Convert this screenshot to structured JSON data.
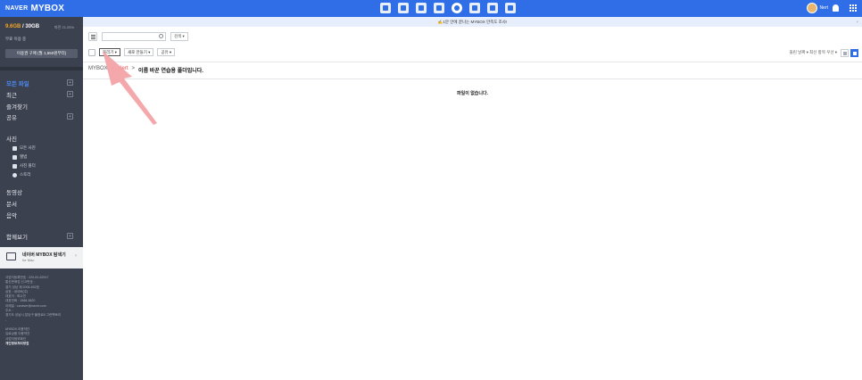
{
  "brand": {
    "naver": "NAVER",
    "mybox": "MYBOX"
  },
  "topbar": {
    "apps": [
      "mail-icon",
      "calendar-icon",
      "memo-icon",
      "contacts-icon",
      "mybox-icon",
      "office-icon",
      "cafe-icon",
      "more-icon"
    ],
    "user_name": "Nert"
  },
  "sidebar": {
    "quota_used": "9.6GB",
    "quota_sep": " / ",
    "quota_total": "30GB",
    "quota_sub": "파란 21.25%",
    "free_text": "무료 이용 중",
    "buy_label": "이용권 구매 (월 1,650원부터)",
    "menu": [
      {
        "label": "모든 파일",
        "plus": "+"
      },
      {
        "label": "최근",
        "plus": "+"
      },
      {
        "label": "즐겨찾기"
      },
      {
        "label": "공유",
        "plus": "+"
      }
    ],
    "photo_title": "사진",
    "photo_items": [
      "모든 사진",
      "앨범",
      "사진 폴더",
      "스토리"
    ],
    "media": [
      "동영상",
      "문서",
      "음악"
    ],
    "shared_title": "함께보기",
    "shared_plus": "+",
    "promo_title": "네이버 MYBOX 탐색기",
    "promo_sub": "for Mac",
    "footer": [
      "사업자등록번호 : 220-81-62517",
      "통신판매업 신고번호 :",
      "경기 성남 제 2006-692호",
      "상호 : 네이버(주)",
      "대표자 : 최수연",
      "대표전화 : 1588-3820",
      "이메일 : ccnaver@naver.com",
      "주소 :",
      "경기도 성남시 분당구 불정로6 그린팩토리",
      "-"
    ],
    "footer_links": [
      "MYBOX 이용약관",
      "유료상품 이용약관",
      "사업자정보확인",
      "개인정보처리방침"
    ]
  },
  "notice": {
    "text": "✍️1분 안에 끝나는 MYBOX 만족도 조사!",
    "close": "×"
  },
  "toolbar": {
    "search_scope": "검색 ▾",
    "upload": "올리기 ▾",
    "new_folder": "새로 만들기 ▾",
    "share": "공유 ▾",
    "sort": "올린 날짜 ▾   최신 항목 우선 ▾"
  },
  "breadcrumb": {
    "root": "MYBOX",
    "sep": ">",
    "mid": "Nert",
    "current": "이름 바꾼 연습용 폴더입니다."
  },
  "empty_text": "파일이 없습니다."
}
